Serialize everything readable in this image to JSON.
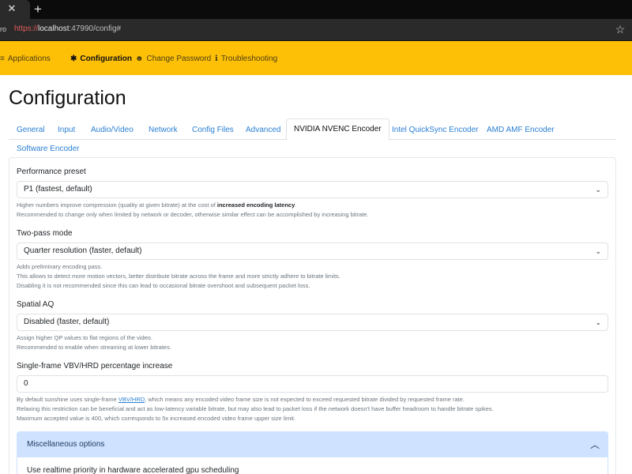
{
  "browser": {
    "tab_close_glyph": "✕",
    "new_tab_glyph": "+",
    "left_chip": "ro",
    "url_scheme": "https://",
    "url_host": "localhost",
    "url_rest": ":47990/config#",
    "bookmark_icon": "star-icon"
  },
  "navbar": {
    "background": "#fec007",
    "items": [
      {
        "label": "Applications",
        "icon": "list-icon"
      },
      {
        "label": "Configuration",
        "icon": "gear-icon"
      },
      {
        "label": "Change Password",
        "icon": "user-key-icon"
      },
      {
        "label": "Troubleshooting",
        "icon": "info-icon"
      }
    ]
  },
  "page": {
    "title": "Configuration"
  },
  "tabs": [
    "General",
    "Input",
    "Audio/Video",
    "Network",
    "Config Files",
    "Advanced",
    "NVIDIA NVENC Encoder",
    "Intel QuickSync Encoder",
    "AMD AMF Encoder",
    "Software Encoder"
  ],
  "active_tab": "NVIDIA NVENC Encoder",
  "form": {
    "preset": {
      "label": "Performance preset",
      "value": "P1 (fastest, default)",
      "help1_pre": "Higher numbers improve compression (quality at given bitrate) at the cost of ",
      "help1_bold": "increased encoding latency",
      "help1_post": ".",
      "help2": "Recommended to change only when limited by network or decoder, otherwise similar effect can be accomplished by increasing bitrate."
    },
    "twopass": {
      "label": "Two-pass mode",
      "value": "Quarter resolution (faster, default)",
      "help1": "Adds preliminary encoding pass.",
      "help2": "This allows to detect more motion vectors, better distribute bitrate across the frame and more strictly adhere to bitrate limits.",
      "help3": "Disabling it is not recommended since this can lead to occasional bitrate overshoot and subsequent packet loss."
    },
    "spatial_aq": {
      "label": "Spatial AQ",
      "value": "Disabled (faster, default)",
      "help1": "Assign higher QP values to flat regions of the video.",
      "help2": "Recommended to enable when streaming at lower bitrates."
    },
    "vbv": {
      "label": "Single-frame VBV/HRD percentage increase",
      "value": "0",
      "help1_pre": "By default sunshine uses single-frame ",
      "help1_link": "VBV/HRD",
      "help1_post": ", which means any encoded video frame size is not expected to exceed requested bitrate divided by requested frame rate.",
      "help2": "Relaxing this restriction can be beneficial and act as low-latency variable bitrate, but may also lead to packet loss if the network doesn't have buffer headroom to handle bitrate spikes.",
      "help3": "Maximum accepted value is 400, which corresponds to 5x increased encoded video frame upper size limit."
    },
    "misc": {
      "title": "Miscellaneous options",
      "item1": "Use realtime priority in hardware accelerated gpu scheduling"
    }
  }
}
